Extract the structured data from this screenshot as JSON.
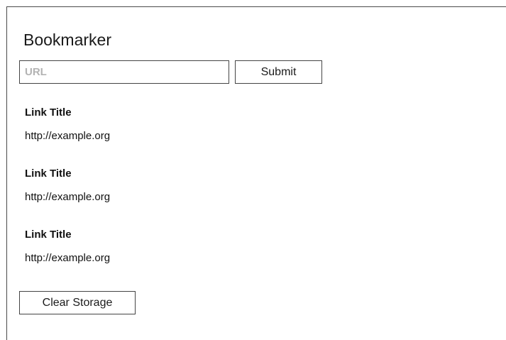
{
  "app": {
    "title": "Bookmarker"
  },
  "form": {
    "url_placeholder": "URL",
    "url_value": "",
    "submit_label": "Submit"
  },
  "bookmarks": [
    {
      "title": "Link Title",
      "url": "http://example.org"
    },
    {
      "title": "Link Title",
      "url": "http://example.org"
    },
    {
      "title": "Link Title",
      "url": "http://example.org"
    }
  ],
  "footer": {
    "clear_label": "Clear Storage"
  }
}
